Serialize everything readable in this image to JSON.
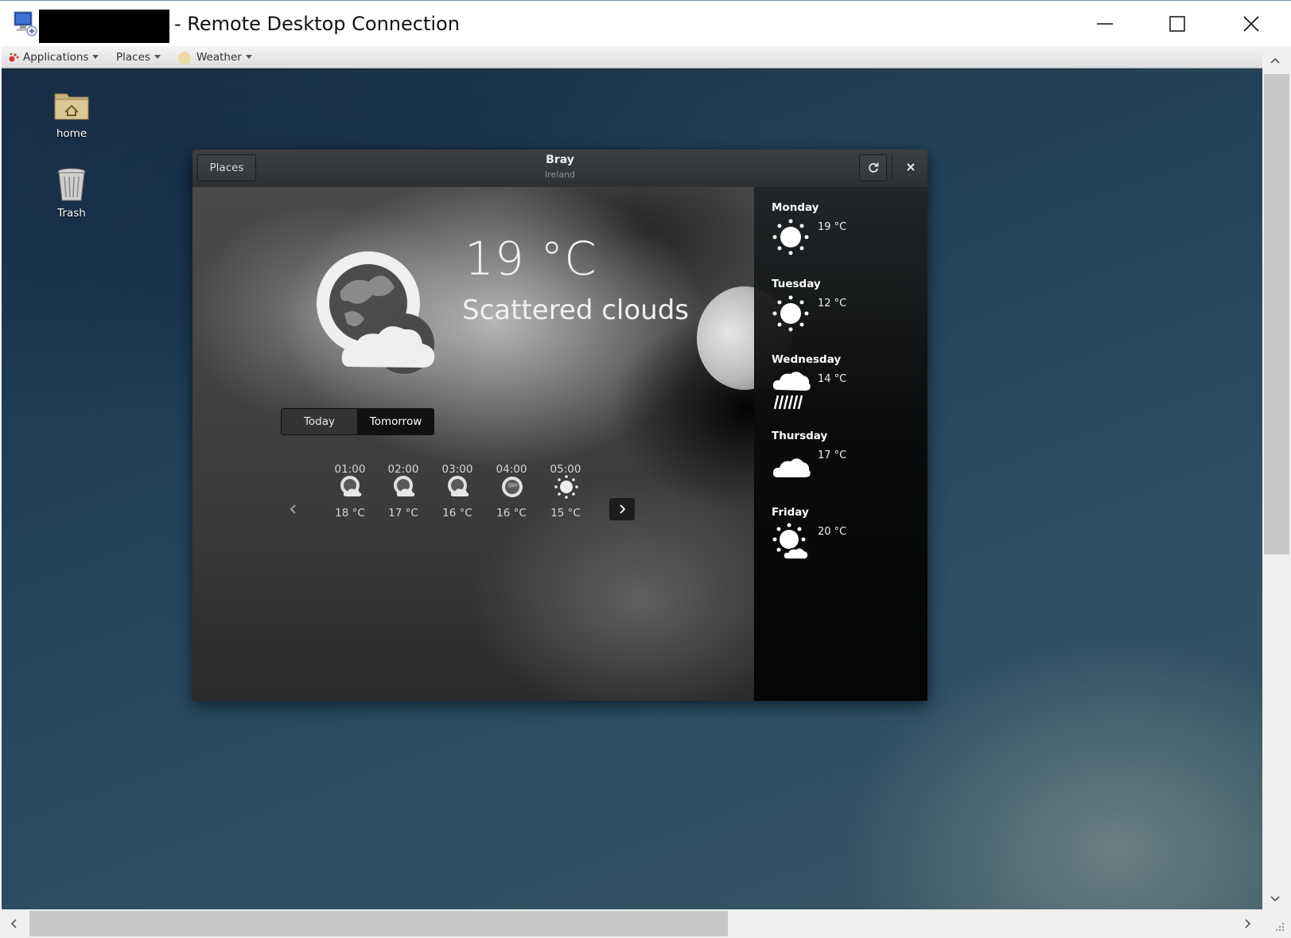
{
  "window": {
    "title": "- Remote Desktop Connection",
    "controls": [
      "minimize",
      "maximize",
      "close"
    ]
  },
  "panel": {
    "applications": "Applications",
    "places": "Places",
    "weather": "Weather"
  },
  "desktop": {
    "icons": [
      {
        "label": "home",
        "icon": "home-folder-icon"
      },
      {
        "label": "Trash",
        "icon": "trash-icon"
      }
    ]
  },
  "weather": {
    "places_button": "Places",
    "city": "Bray",
    "country": "Ireland",
    "current_temp": "19 °C",
    "current_condition": "Scattered clouds",
    "tabs": {
      "today": "Today",
      "tomorrow": "Tomorrow",
      "selected": "Tomorrow"
    },
    "hourly": [
      {
        "time": "01:00",
        "temp": "18 °C",
        "icon": "night-clouds-icon"
      },
      {
        "time": "02:00",
        "temp": "17 °C",
        "icon": "night-clouds-icon"
      },
      {
        "time": "03:00",
        "temp": "16 °C",
        "icon": "night-clouds-icon"
      },
      {
        "time": "04:00",
        "temp": "16 °C",
        "icon": "moon-icon"
      },
      {
        "time": "05:00",
        "temp": "15 °C",
        "icon": "sun-icon"
      }
    ],
    "forecast": [
      {
        "day": "Monday",
        "temp": "19 °C",
        "icon": "sun-icon"
      },
      {
        "day": "Tuesday",
        "temp": "12 °C",
        "icon": "sun-icon"
      },
      {
        "day": "Wednesday",
        "temp": "14 °C",
        "icon": "rain-icon"
      },
      {
        "day": "Thursday",
        "temp": "17 °C",
        "icon": "cloud-icon"
      },
      {
        "day": "Friday",
        "temp": "20 °C",
        "icon": "sun-cloud-icon"
      }
    ]
  }
}
